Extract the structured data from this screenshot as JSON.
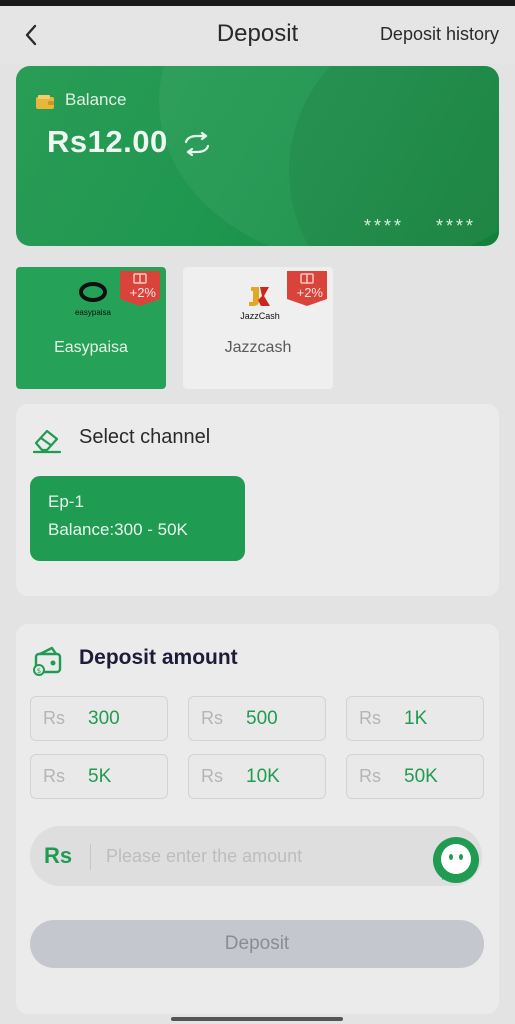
{
  "header": {
    "title": "Deposit",
    "history_label": "Deposit history"
  },
  "balance_card": {
    "label": "Balance",
    "amount": "Rs12.00",
    "mask_1": "****",
    "mask_2": "****"
  },
  "payment_methods": [
    {
      "name": "Easypaisa",
      "logo_text": "easypaisa",
      "bonus": "+2%",
      "selected": true
    },
    {
      "name": "Jazzcash",
      "logo_text": "JazzCash",
      "bonus": "+2%",
      "selected": false
    }
  ],
  "channel_section": {
    "title": "Select channel",
    "channels": [
      {
        "name": "Ep-1",
        "range": "Balance:300 - 50K"
      }
    ]
  },
  "amount_section": {
    "title": "Deposit amount",
    "currency": "Rs",
    "presets": [
      "300",
      "500",
      "1K",
      "5K",
      "10K",
      "50K"
    ],
    "input_currency": "Rs",
    "input_placeholder": "Please enter the amount",
    "submit_label": "Deposit"
  },
  "colors": {
    "primary_green": "#1f9c52",
    "bonus_red": "#d9433a",
    "disabled_button": "#c5c7cf"
  },
  "icons": [
    "back-icon",
    "wallet-icon",
    "refresh-icon",
    "gift-icon",
    "eraser-icon",
    "cash-wallet-icon",
    "chat-icon"
  ]
}
